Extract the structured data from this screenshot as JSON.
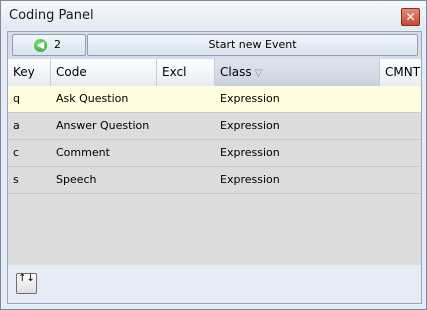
{
  "window": {
    "title": "Coding Panel",
    "close_glyph": "✕"
  },
  "toolbar": {
    "back_icon": "green-circle-left-arrow",
    "back_count": "2",
    "new_event_label": "Start new Event"
  },
  "table": {
    "columns": [
      "Key",
      "Code",
      "Excl",
      "Class",
      "CMNT"
    ],
    "sort_glyph": "▽",
    "rows": [
      {
        "key": "q",
        "code": "Ask Question",
        "excl": "",
        "class": "Expression",
        "cmnt": ""
      },
      {
        "key": "a",
        "code": "Answer Question",
        "excl": "",
        "class": "Expression",
        "cmnt": ""
      },
      {
        "key": "c",
        "code": "Comment",
        "excl": "",
        "class": "Expression",
        "cmnt": ""
      },
      {
        "key": "s",
        "code": "Speech",
        "excl": "",
        "class": "Expression",
        "cmnt": ""
      }
    ]
  },
  "footer": {
    "sort_button_glyph": "↑↓"
  },
  "colors": {
    "selected_row": "#fffcdf",
    "accent": "#2a9a2a",
    "close": "#c24a37"
  }
}
